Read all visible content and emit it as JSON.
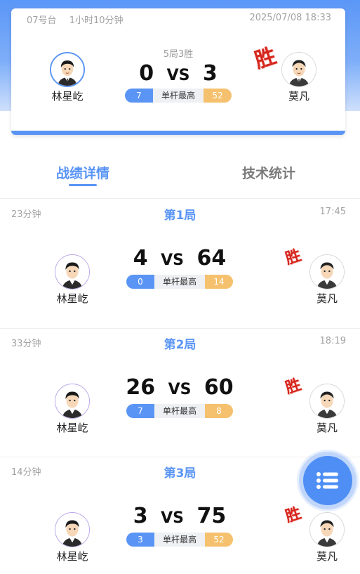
{
  "colors": {
    "accent": "#5a95f5",
    "gold": "#f5c16e",
    "win_red": "#d7261d"
  },
  "match": {
    "table": "07号台",
    "duration": "1小时10分钟",
    "datetime": "2025/07/08 18:33",
    "record": "5局3胜",
    "player_left": {
      "name": "林星屹",
      "score": "0"
    },
    "player_right": {
      "name": "莫凡",
      "score": "3"
    },
    "vs": "VS",
    "high_break_label": "单杆最高",
    "high_break_left": "7",
    "high_break_right": "52",
    "win_label": "胜"
  },
  "tabs": [
    {
      "label": "战绩详情",
      "active": true
    },
    {
      "label": "技术统计",
      "active": false
    }
  ],
  "games": [
    {
      "title": "第1局",
      "duration": "23分钟",
      "time": "17:45",
      "left_name": "林星屹",
      "right_name": "莫凡",
      "left_score": "4",
      "right_score": "64",
      "vs": "VS",
      "break_label": "单杆最高",
      "left_break": "0",
      "right_break": "14",
      "win_label": "胜"
    },
    {
      "title": "第2局",
      "duration": "33分钟",
      "time": "18:19",
      "left_name": "林星屹",
      "right_name": "莫凡",
      "left_score": "26",
      "right_score": "60",
      "vs": "VS",
      "break_label": "单杆最高",
      "left_break": "7",
      "right_break": "8",
      "win_label": "胜"
    },
    {
      "title": "第3局",
      "duration": "14分钟",
      "time": "",
      "left_name": "林星屹",
      "right_name": "莫凡",
      "left_score": "3",
      "right_score": "75",
      "vs": "VS",
      "break_label": "单杆最高",
      "left_break": "3",
      "right_break": "52",
      "win_label": "胜"
    }
  ],
  "fab": {
    "icon": "list-menu-icon"
  }
}
